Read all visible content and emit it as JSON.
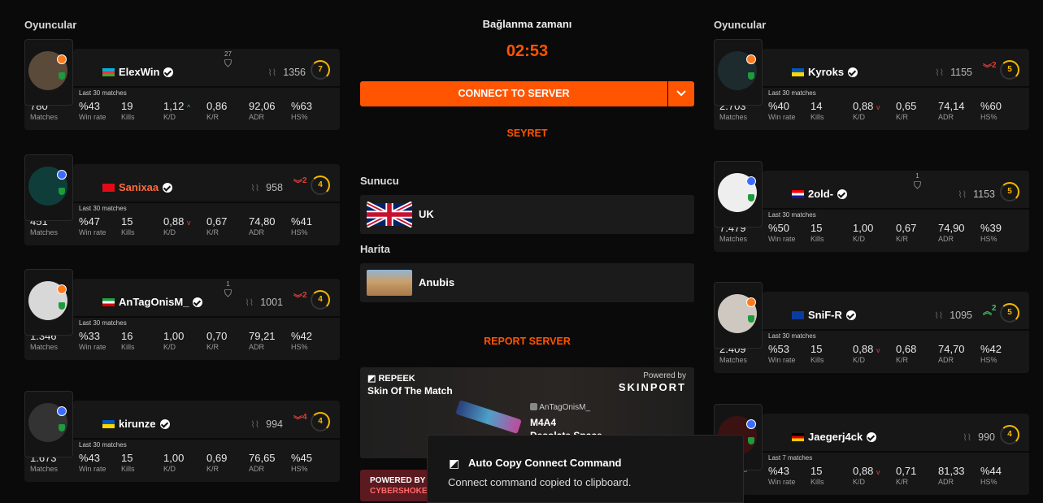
{
  "left_title": "Oyuncular",
  "right_title": "Oyuncular",
  "center": {
    "connect_label": "Bağlanma zamanı",
    "timer": "02:53",
    "connect_button": "CONNECT TO SERVER",
    "dropdown_icon": "chevron-down-icon",
    "watch": "SEYRET",
    "server_label": "Sunucu",
    "server_value": "UK",
    "map_label": "Harita",
    "map_value": "Anubis",
    "report": "REPORT SERVER"
  },
  "skin": {
    "brand": "REPEEK",
    "title": "Skin Of The Match",
    "powered": "Powered by",
    "sponsor": "SKINPORT",
    "player": "AnTagOnisM_",
    "weapon": "M4A4",
    "skin_name": "Desolate Space"
  },
  "cyber": {
    "line1": "POWERED BY",
    "line2": "CYBERSHOKE"
  },
  "toast": {
    "title": "Auto Copy Connect Command",
    "message": "Connect command copied to clipboard."
  },
  "labels": {
    "matches": "Matches",
    "winrate": "Win rate",
    "kills": "Kills",
    "kd": "K/D",
    "kr": "K/R",
    "adr": "ADR",
    "hs": "HS%"
  },
  "left": [
    {
      "name": "ElexWin",
      "name_color": "#ffffff",
      "flag": "az",
      "extra": "27",
      "elo": "1356",
      "change": "",
      "change_dir": "",
      "level": "7",
      "level_pct": 0.7,
      "note": "Last 30 matches",
      "matches": "780",
      "winrate": "%43",
      "kills": "19",
      "kd": "1,12",
      "kd_dir": "up",
      "kr": "0,86",
      "adr": "92,06",
      "hs": "%63"
    },
    {
      "name": "Sanixaa",
      "name_color": "#ff6a3d",
      "flag": "tr",
      "extra": "",
      "elo": "958",
      "change": "2",
      "change_dir": "down",
      "level": "4",
      "level_pct": 0.4,
      "note": "Last 30 matches",
      "matches": "451",
      "winrate": "%47",
      "kills": "15",
      "kd": "0,88",
      "kd_dir": "down",
      "kr": "0,67",
      "adr": "74,80",
      "hs": "%41"
    },
    {
      "name": "AnTagOnisM_",
      "name_color": "#ffffff",
      "flag": "ir",
      "extra": "1",
      "elo": "1001",
      "change": "2",
      "change_dir": "down",
      "level": "4",
      "level_pct": 0.4,
      "note": "Last 30 matches",
      "matches": "1.346",
      "winrate": "%33",
      "kills": "16",
      "kd": "1,00",
      "kd_dir": "",
      "kr": "0,70",
      "adr": "79,21",
      "hs": "%42"
    },
    {
      "name": "kirunze",
      "name_color": "#ffffff",
      "flag": "ua",
      "extra": "",
      "elo": "994",
      "change": "4",
      "change_dir": "down",
      "level": "4",
      "level_pct": 0.4,
      "note": "Last 30 matches",
      "matches": "1.673",
      "winrate": "%43",
      "kills": "15",
      "kd": "1,00",
      "kd_dir": "",
      "kr": "0,69",
      "adr": "76,65",
      "hs": "%45"
    }
  ],
  "right": [
    {
      "name": "Kyroks",
      "name_color": "#ffffff",
      "flag": "ua",
      "extra": "",
      "elo": "1155",
      "change": "2",
      "change_dir": "down",
      "level": "5",
      "level_pct": 0.5,
      "note": "Last 30 matches",
      "matches": "2.703",
      "winrate": "%40",
      "kills": "14",
      "kd": "0,88",
      "kd_dir": "down",
      "kr": "0,65",
      "adr": "74,14",
      "hs": "%60"
    },
    {
      "name": "2old-",
      "name_color": "#ffffff",
      "flag": "hr",
      "extra": "1",
      "elo": "1153",
      "change": "",
      "change_dir": "",
      "level": "5",
      "level_pct": 0.5,
      "note": "Last 30 matches",
      "matches": "7.479",
      "winrate": "%50",
      "kills": "15",
      "kd": "1,00",
      "kd_dir": "",
      "kr": "0,67",
      "adr": "74,90",
      "hs": "%39"
    },
    {
      "name": "SniF-R",
      "name_color": "#ffffff",
      "flag": "eu",
      "extra": "",
      "elo": "1095",
      "change": "2",
      "change_dir": "up",
      "level": "5",
      "level_pct": 0.5,
      "note": "Last 30 matches",
      "matches": "2.409",
      "winrate": "%53",
      "kills": "15",
      "kd": "0,88",
      "kd_dir": "down",
      "kr": "0,68",
      "adr": "74,70",
      "hs": "%42"
    },
    {
      "name": "Jaegerj4ck",
      "name_color": "#ffffff",
      "flag": "de",
      "extra": "",
      "elo": "990",
      "change": "",
      "change_dir": "",
      "level": "4",
      "level_pct": 0.4,
      "note": "Last 7 matches",
      "matches": "",
      "winrate": "%43",
      "kills": "15",
      "kd": "0,88",
      "kd_dir": "down",
      "kr": "0,71",
      "adr": "81,33",
      "hs": "%44"
    }
  ]
}
